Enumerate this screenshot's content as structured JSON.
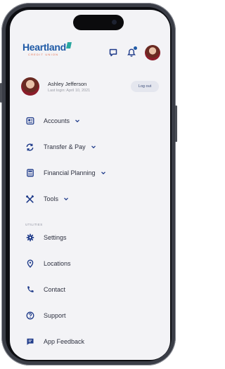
{
  "colors": {
    "brand_blue": "#1f5aa6",
    "accent_teal": "#2aa7a0",
    "logo_orange": "#e46b4a",
    "icon_navy": "#1f3b8a",
    "text_dark": "#2e3140",
    "muted": "#9a9ca6"
  },
  "header": {
    "logo_main": "Heartland",
    "logo_sub": "CREDIT UNION",
    "icons": [
      "chat-icon",
      "bell-icon",
      "avatar"
    ]
  },
  "profile": {
    "name": "Ashley Jefferson",
    "last_login": "Last login: April 10, 2021",
    "logout_label": "Log out"
  },
  "menu": {
    "main_items": [
      {
        "label": "Accounts",
        "icon": "accounts-icon",
        "expandable": true
      },
      {
        "label": "Transfer & Pay",
        "icon": "transfer-icon",
        "expandable": true
      },
      {
        "label": "Financial Planning",
        "icon": "calculator-icon",
        "expandable": true
      },
      {
        "label": "Tools",
        "icon": "tools-icon",
        "expandable": true
      }
    ],
    "section_label": "UTILITIES",
    "utility_items": [
      {
        "label": "Settings",
        "icon": "gear-icon"
      },
      {
        "label": "Locations",
        "icon": "location-pin-icon"
      },
      {
        "label": "Contact",
        "icon": "phone-icon"
      },
      {
        "label": "Support",
        "icon": "help-icon"
      },
      {
        "label": "App Feedback",
        "icon": "feedback-icon"
      }
    ]
  }
}
